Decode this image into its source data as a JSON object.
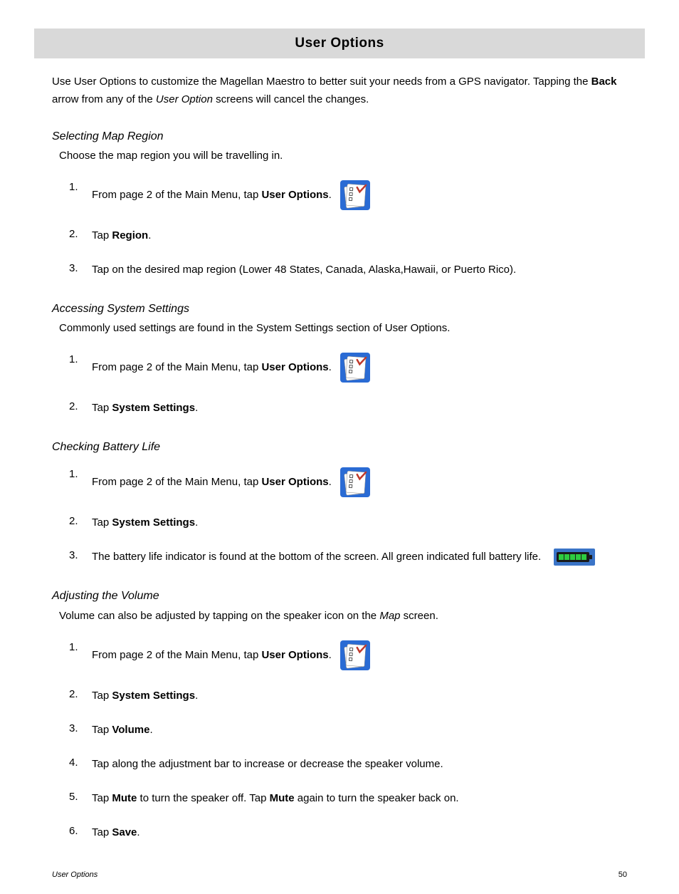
{
  "title": "User Options",
  "intro": {
    "p1a": "Use User Options to customize the Magellan Maestro to better suit your needs from a GPS navigator. Tapping the ",
    "p1b": "Back",
    "p1c": " arrow from any of the ",
    "p1d": "User Option",
    "p1e": " screens will cancel the changes."
  },
  "sections": {
    "mapRegion": {
      "title": "Selecting Map Region",
      "desc": "Choose the map region you will be travelling in.",
      "steps": {
        "s1a": "From page 2 of the Main Menu, tap ",
        "s1b": "User Options",
        "s1c": ".",
        "s2a": "Tap ",
        "s2b": "Region",
        "s2c": ".",
        "s3": "Tap on the desired map region (Lower 48 States, Canada, Alaska,Hawaii, or Puerto Rico)."
      }
    },
    "systemSettings": {
      "title": "Accessing System Settings",
      "desc": "Commonly used settings are found in the System Settings section of User Options.",
      "steps": {
        "s1a": "From page 2 of the Main Menu, tap ",
        "s1b": "User Options",
        "s1c": ".",
        "s2a": "Tap ",
        "s2b": "System Settings",
        "s2c": "."
      }
    },
    "battery": {
      "title": "Checking Battery Life",
      "steps": {
        "s1a": "From page 2 of the Main Menu, tap ",
        "s1b": "User Options",
        "s1c": ".",
        "s2a": "Tap ",
        "s2b": "System Settings",
        "s2c": ".",
        "s3": "The battery life indicator is found at the bottom of the screen.  All green indicated full battery life."
      }
    },
    "volume": {
      "title": "Adjusting the Volume",
      "descA": "Volume can also be adjusted by tapping on the speaker icon on the ",
      "descB": "Map",
      "descC": " screen.",
      "steps": {
        "s1a": "From page 2 of the Main Menu, tap ",
        "s1b": "User Options",
        "s1c": ".",
        "s2a": "Tap ",
        "s2b": "System Settings",
        "s2c": ".",
        "s3a": "Tap ",
        "s3b": "Volume",
        "s3c": ".",
        "s4": "Tap along the adjustment bar to increase or decrease the speaker volume.",
        "s5a": "Tap ",
        "s5b": "Mute",
        "s5c": " to turn the speaker off.  Tap ",
        "s5d": "Mute",
        "s5e": " again to turn the speaker back on.",
        "s6a": "Tap ",
        "s6b": "Save",
        "s6c": "."
      }
    }
  },
  "nums": {
    "n1": "1.",
    "n2": "2.",
    "n3": "3.",
    "n4": "4.",
    "n5": "5.",
    "n6": "6."
  },
  "footer": {
    "left": "User Options",
    "right": "50"
  }
}
